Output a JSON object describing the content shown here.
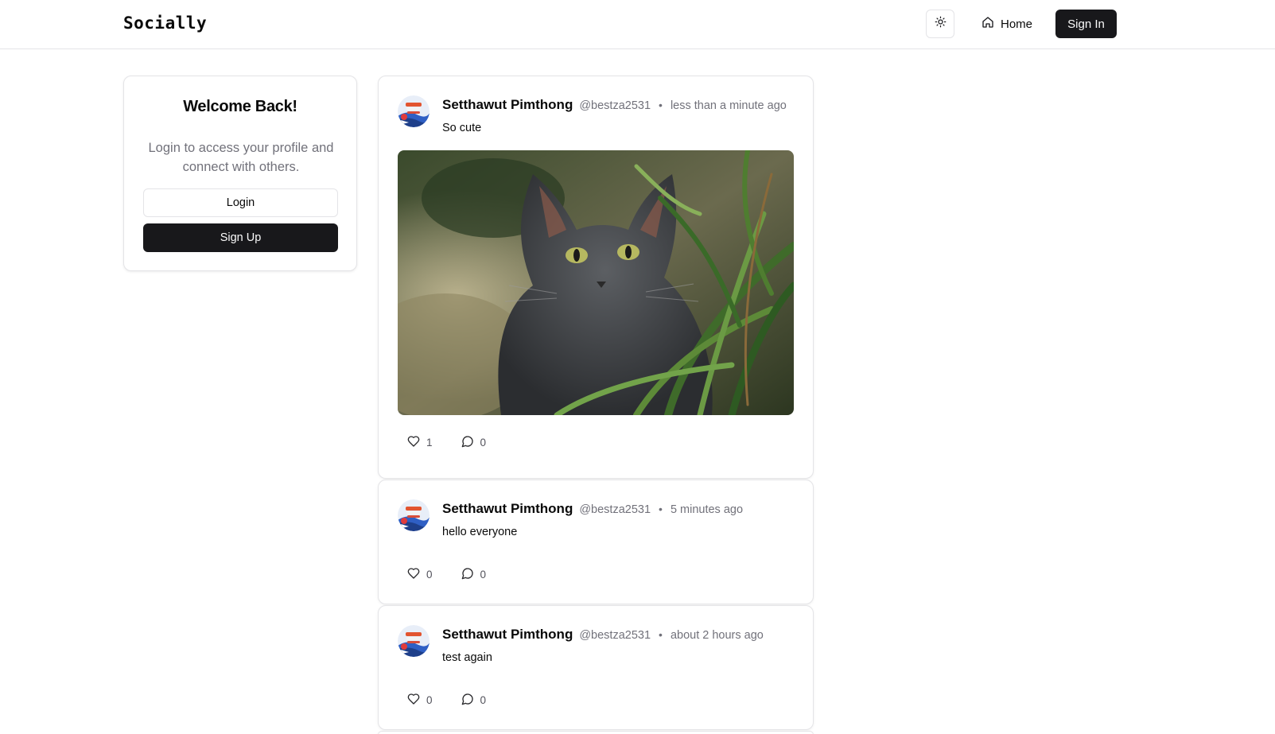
{
  "navbar": {
    "brand": "Socially",
    "theme_icon": "sun-icon",
    "home_label": "Home",
    "home_icon": "home-icon",
    "signin_label": "Sign In"
  },
  "welcome": {
    "title": "Welcome Back!",
    "description": "Login to access your profile and connect with others.",
    "login_label": "Login",
    "signup_label": "Sign Up"
  },
  "posts": [
    {
      "author": "Setthawut Pimthong",
      "handle": "@bestza2531",
      "separator": "•",
      "time": "less than a minute ago",
      "content": "So cute",
      "image": "grey-cat-in-grass-photo",
      "likes": "1",
      "comments": "0"
    },
    {
      "author": "Setthawut Pimthong",
      "handle": "@bestza2531",
      "separator": "•",
      "time": "5 minutes ago",
      "content": "hello everyone",
      "likes": "0",
      "comments": "0"
    },
    {
      "author": "Setthawut Pimthong",
      "handle": "@bestza2531",
      "separator": "•",
      "time": "about 2 hours ago",
      "content": "test again",
      "likes": "0",
      "comments": "0"
    }
  ],
  "icons": {
    "like": "heart-icon",
    "comment": "message-circle-icon"
  },
  "colors": {
    "primary": "#18181b",
    "muted_text": "#71717a",
    "border": "#e4e4e7"
  }
}
